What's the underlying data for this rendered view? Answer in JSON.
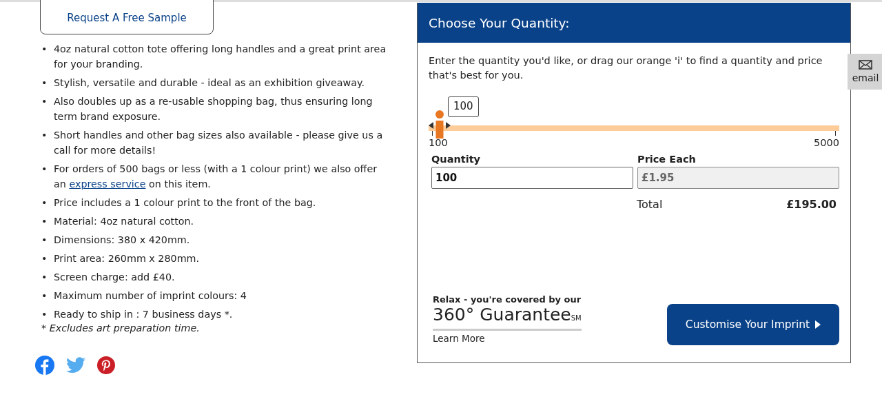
{
  "sample_button": "Request A Free Sample",
  "features": [
    {
      "bullet": "•",
      "text": "4oz natural cotton tote offering long handles and a great print area for your branding."
    },
    {
      "bullet": "•",
      "text": "Stylish, versatile and durable - ideal as an exhibition giveaway."
    },
    {
      "bullet": "•",
      "text": "Also doubles up as a re-usable shopping bag, thus ensuring long term brand exposure."
    },
    {
      "bullet": "•",
      "text": "Short handles and other bag sizes also available - please give us a call for more details!"
    },
    {
      "bullet": "•",
      "text": "For orders of 500 bags or less (with a 1 colour print) we also offer an ",
      "link": "express service",
      "after": " on this item."
    },
    {
      "bullet": "•",
      "text": "Price includes a 1 colour print to the front of the bag."
    },
    {
      "bullet": "•",
      "text": "Material: 4oz natural cotton."
    },
    {
      "bullet": "•",
      "text": "Dimensions: 380 x 420mm."
    },
    {
      "bullet": "•",
      "text": "Print area: 260mm x 280mm."
    },
    {
      "bullet": "•",
      "text": "Screen charge: add £40."
    },
    {
      "bullet": "•",
      "text": "Maximum number of imprint colours: 4"
    },
    {
      "bullet": "•",
      "text": "Ready to ship in : 7 business days *."
    }
  ],
  "footnote": "* Excludes art preparation time.",
  "social": [
    {
      "kind": "facebook"
    },
    {
      "kind": "twitter"
    },
    {
      "kind": "pinterest"
    }
  ],
  "quantity_panel": {
    "title": "Choose Your Quantity:",
    "intro": "Enter the quantity you'd like, or drag our orange 'i' to find a quantity and price that's best for you.",
    "slider": {
      "bubble": "100",
      "level": 0,
      "min_label": "100",
      "max_label": "5000"
    },
    "quantity_label": "Quantity",
    "quantity_value": "100",
    "price_label": "Price Each",
    "price_value": "£1.95",
    "total_label": "Total",
    "total_value": "£195.00",
    "guarantee": {
      "intro": "Relax - you're covered by our",
      "title": "360° Guarantee",
      "mark": "SM",
      "link": "Learn More"
    },
    "customise_button": "Customise Your Imprint"
  },
  "email_tab": "email"
}
